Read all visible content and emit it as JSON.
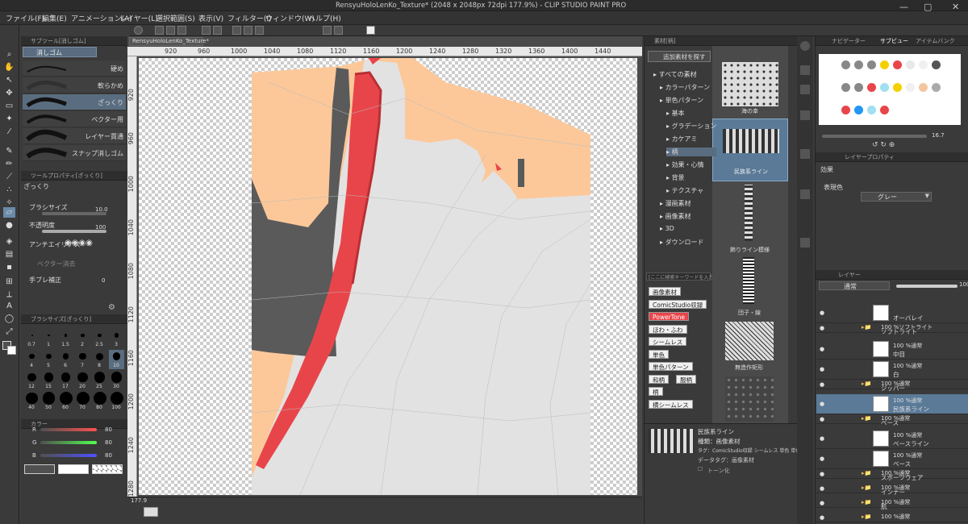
{
  "app": {
    "title": "RensyuHoloLenKo_Texture* (2048 x 2048px 72dpi 177.9%) - CLIP STUDIO PAINT PRO"
  },
  "menu": [
    "ファイル(F)",
    "編集(E)",
    "アニメーション(A)",
    "レイヤー(L)",
    "選択範囲(S)",
    "表示(V)",
    "フィルター(I)",
    "ウィンドウ(W)",
    "ヘルプ(H)"
  ],
  "canvas_tab": "RensyuHoloLenKo_Texture*",
  "subtool": {
    "header": "サブツール[消しゴム]",
    "active_tab": "消しゴム",
    "brushes": [
      "硬め",
      "軟らかめ",
      "ざっくり",
      "ベクター用",
      "レイヤー貫通",
      "スナップ消しゴム"
    ]
  },
  "toolprop": {
    "header": "ツールプロパティ[ざっくり]",
    "name": "ざっくり",
    "brush_size_label": "ブラシサイズ",
    "brush_size_value": "10.0",
    "opacity_label": "不透明度",
    "opacity_value": "100",
    "antialias_label": "アンチエイリアス",
    "vector_erase_label": "ベクター消去",
    "stabilize_label": "手ブレ補正",
    "stabilize_value": "0"
  },
  "brushsize": {
    "header": "ブラシサイズ[ざっくり]",
    "sizes": [
      "0.7",
      "1",
      "1.5",
      "2",
      "2.5",
      "3",
      "4",
      "5",
      "6",
      "7",
      "8",
      "10",
      "12",
      "15",
      "17",
      "20",
      "25",
      "30",
      "40",
      "50",
      "60",
      "70",
      "80",
      "100"
    ]
  },
  "colorpanel": {
    "header": "カラー",
    "r_label": "R",
    "r_value": "80",
    "g_label": "G",
    "g_value": "80",
    "b_label": "B",
    "b_value": "80"
  },
  "ruler_h": [
    "920",
    "960",
    "1000",
    "1040",
    "1080",
    "1120",
    "1160",
    "1200",
    "1240",
    "1280",
    "1320",
    "1360",
    "1400",
    "1440"
  ],
  "ruler_v": [
    "920",
    "960",
    "1000",
    "1040",
    "1080",
    "1120",
    "1160",
    "1200",
    "1240",
    "1280"
  ],
  "status": {
    "zoom": "177.9"
  },
  "material": {
    "header": "素材[柄]",
    "add_button": "追加素材を探す",
    "tree": [
      "すべての素材",
      "カラーパターン",
      "単色パターン",
      "基本",
      "グラデーション",
      "カケアミ",
      "柄",
      "効果・心情",
      "背景",
      "テクスチャ",
      "漫画素材",
      "画像素材",
      "3D",
      "ダウンロード"
    ],
    "tags_header": "[ここに検索キーワードを入力]",
    "tags": [
      "画像素材",
      "ComicStudio収録",
      "PowerTone",
      "ほわ・ふわ",
      "シームレス",
      "単色",
      "単色パターン",
      "和柄",
      "服柄",
      "柄",
      "横シームレス"
    ],
    "items": [
      "海の幸",
      "民族系ライン",
      "飾りライン模様",
      "団子・線",
      "無造作矩形"
    ],
    "detail": {
      "name": "民族系ライン",
      "kind": "種類：画像素材",
      "tag": "タグ：ComicStudio収録 シームレス 単色 単色パ",
      "datatag": "データタグ：画像素材",
      "tone": "トーン化"
    }
  },
  "colorset": {
    "tabs": [
      "ナビゲーター",
      "サブビュー",
      "アイテムバンク"
    ],
    "swatches": [
      "#888888",
      "#888888",
      "#888888",
      "#f5d000",
      "#e8454a",
      "#e8e8e8",
      "#f0f0f0",
      "#555555",
      "#888888",
      "#888888",
      "#e8454a",
      "#a0e0f0",
      "#f5d000",
      "#f0f0f0",
      "#f4c6a0",
      "#aaaaaa",
      "#e8454a",
      "#2196f3",
      "#a0e0f0",
      "#e8454a"
    ],
    "zoom_value": "16.7"
  },
  "layerprop": {
    "header": "レイヤープロパティ",
    "effect_label": "効果",
    "color_label": "表現色",
    "color_value": "グレー"
  },
  "layers": {
    "header": "レイヤー",
    "blend": "通常",
    "opacity": "100",
    "items": [
      {
        "kind": "layer",
        "t1": "",
        "t2": "オーバレイ"
      },
      {
        "kind": "folder",
        "t1": "100 %ソフトライト",
        "t2": "ソフトライト"
      },
      {
        "kind": "layer",
        "t1": "100 %通常",
        "t2": "中目"
      },
      {
        "kind": "layer",
        "t1": "100 %通常",
        "t2": "白"
      },
      {
        "kind": "folder",
        "t1": "100 %通常",
        "t2": "ジッパー"
      },
      {
        "kind": "layer",
        "t1": "100 %通常",
        "t2": "民族系ライン"
      },
      {
        "kind": "folder",
        "t1": "100 %通常",
        "t2": "ベース"
      },
      {
        "kind": "layer",
        "t1": "100 %通常",
        "t2": "ベースライン"
      },
      {
        "kind": "layer",
        "t1": "100 %通常",
        "t2": "ベース"
      },
      {
        "kind": "folder",
        "t1": "100 %通常",
        "t2": "スポーツウェア"
      },
      {
        "kind": "folder",
        "t1": "100 %通常",
        "t2": "インナー"
      },
      {
        "kind": "folder",
        "t1": "100 %通常",
        "t2": "肌"
      },
      {
        "kind": "folder",
        "t1": "100 %通常",
        "t2": ""
      }
    ]
  }
}
